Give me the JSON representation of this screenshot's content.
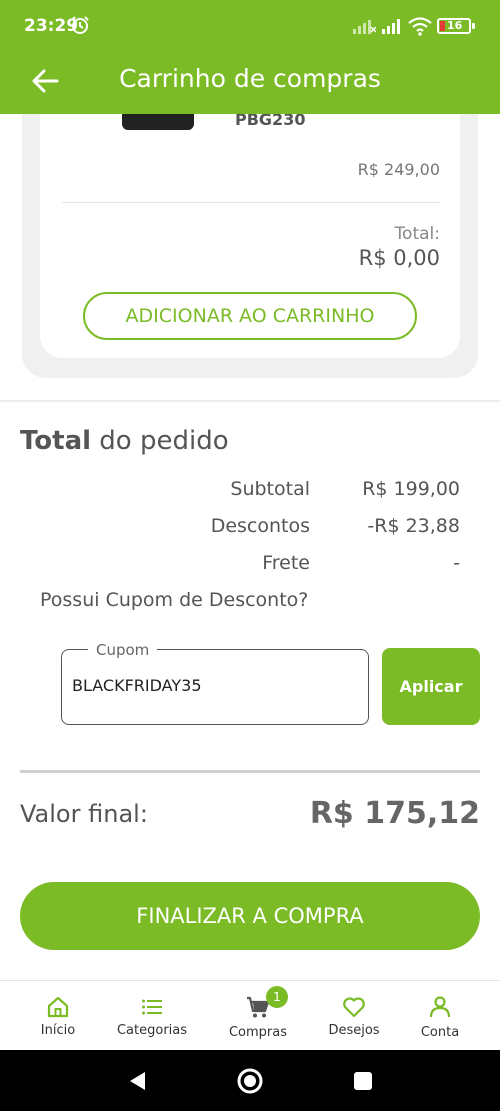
{
  "status_bar": {
    "time": "23:29",
    "battery_level": "16",
    "icons": [
      "alarm-icon",
      "signal-icon",
      "signal-icon",
      "wifi-icon",
      "battery-icon"
    ]
  },
  "app_bar": {
    "title": "Carrinho de compras",
    "back_icon": "arrow-left-icon"
  },
  "product": {
    "code": "PBG230",
    "price": "R$ 249,00",
    "total_label": "Total:",
    "total_value": "R$ 0,00",
    "add_button": "ADICIONAR AO CARRINHO"
  },
  "order": {
    "title_bold": "Total",
    "title_rest": " do pedido",
    "subtotal_label": "Subtotal",
    "subtotal_value": "R$ 199,00",
    "discount_label": "Descontos",
    "discount_value": "-R$ 23,88",
    "shipping_label": "Frete",
    "shipping_value": "-",
    "coupon_question": "Possui Cupom de Desconto?",
    "coupon_field_label": "Cupom",
    "coupon_value": "BLACKFRIDAY35",
    "apply_button": "Aplicar",
    "final_label": "Valor final:",
    "final_value": "R$ 175,12",
    "finish_button": "FINALIZAR A COMPRA"
  },
  "bottom_nav": {
    "items": [
      {
        "label": "Início",
        "icon": "home-icon"
      },
      {
        "label": "Categorias",
        "icon": "list-icon"
      },
      {
        "label": "Compras",
        "icon": "cart-icon",
        "badge": "1"
      },
      {
        "label": "Desejos",
        "icon": "heart-icon"
      },
      {
        "label": "Conta",
        "icon": "person-icon"
      }
    ]
  },
  "system_nav": [
    "back-triangle-icon",
    "home-circle-icon",
    "recents-square-icon"
  ],
  "colors": {
    "brand_green": "#7bbb26",
    "text": "#555555",
    "battery_low": "#e53935"
  }
}
